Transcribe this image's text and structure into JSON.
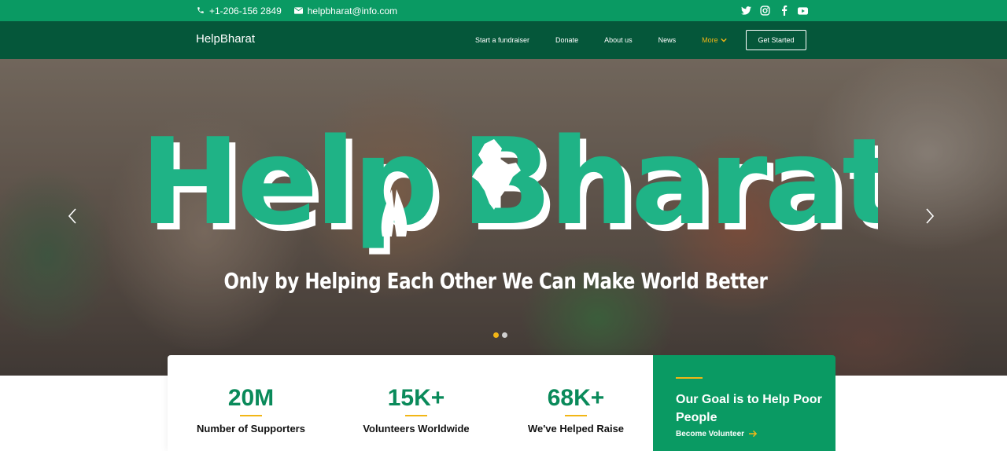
{
  "topbar": {
    "phone": "+1-206-156 2849",
    "email": "helpbharat@info.com",
    "phone_icon": "phone-icon",
    "email_icon": "mail-icon",
    "social": [
      "twitter-icon",
      "instagram-icon",
      "facebook-icon",
      "youtube-icon"
    ]
  },
  "nav": {
    "brand": "HelpBharat",
    "links": [
      "Start a fundraiser",
      "Donate",
      "About us",
      "News"
    ],
    "more": "More",
    "cta": "Get Started"
  },
  "hero": {
    "title_part1": "Help",
    "title_part2": "Bharat",
    "tagline": "Only by Helping Each Other We Can Make World Better",
    "slide_count": 2,
    "active_slide": 1
  },
  "stats": [
    {
      "value": "20M",
      "label": "Number of Supporters"
    },
    {
      "value": "15K+",
      "label": "Volunteers Worldwide"
    },
    {
      "value": "68K+",
      "label": "We've Helped Raise"
    }
  ],
  "goal": {
    "heading": "Our Goal is to Help Poor People",
    "link": "Become Volunteer"
  },
  "colors": {
    "primary": "#0a9a63",
    "dark": "#05573a",
    "accent": "#f2b616",
    "title_green": "#1fb386"
  }
}
